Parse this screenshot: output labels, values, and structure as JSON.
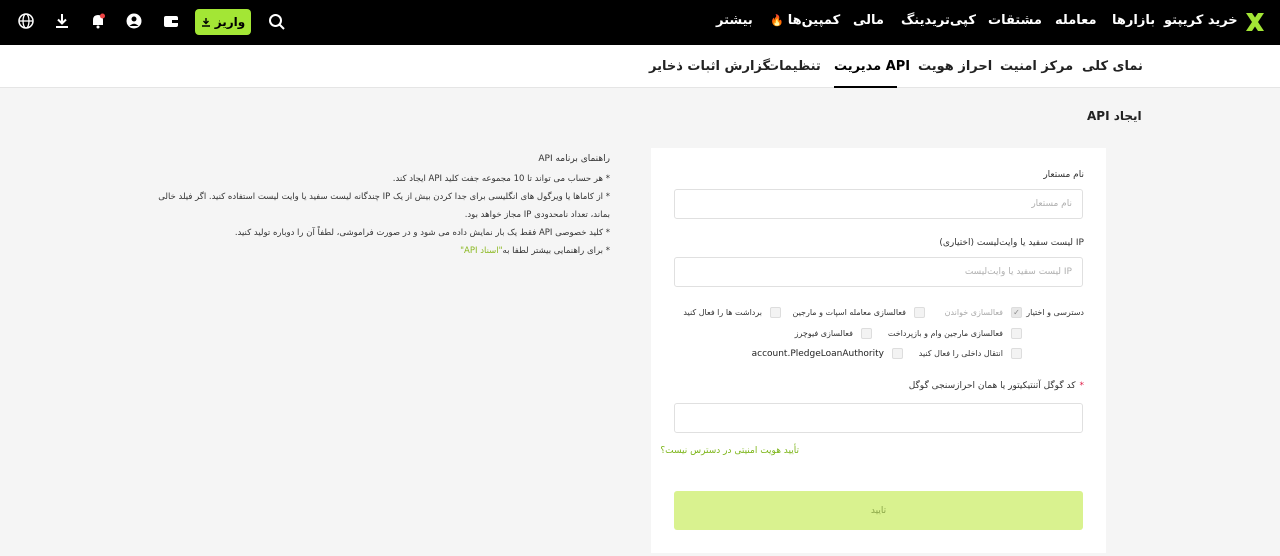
{
  "topbar": {
    "nav": [
      "خرید کریپتو",
      "بازارها",
      "معامله",
      "مشتقات",
      "کپی‌تریدینگ",
      "مالی",
      "کمپین‌ها",
      "بیشتر"
    ],
    "deposit_label": "واریز"
  },
  "subnav": {
    "tabs": [
      "نمای کلی",
      "مرکز امنیت",
      "احراز هویت",
      "مدیریت API",
      "تنظیمات",
      "گزارش اثبات ذخایر"
    ],
    "active": "مدیریت API"
  },
  "page_title": "ایجاد API",
  "guide": {
    "title": "راهنمای برنامه API",
    "items": [
      "* هر حساب می تواند تا 10 مجموعه جفت کلید API ایجاد کند.",
      "* از کاماها یا ویرگول های انگلیسی برای جدا کردن بیش از یک IP چندگانه لیست سفید یا وایت لیست استفاده کنید. اگر فیلد خالی بماند، تعداد نامحدودی IP مجاز خواهد بود.",
      "* کلید خصوصی API فقط یک بار نمایش داده می شود و در صورت فراموشی، لطفاً آن را دوباره تولید کنید.",
      "* برای راهنمایی بیشتر لطفا به"
    ],
    "link": "\"اسناد API\""
  },
  "form": {
    "name_label": "نام مستعار",
    "name_placeholder": "نام مستعار",
    "ip_label": "IP لیست سفید یا وایت‌لیست (اختیاری)",
    "ip_placeholder": "IP لیست سفید یا وایت‌لیست",
    "permissions_label": "دسترسی و اختیار",
    "permissions": [
      {
        "label": "فعالسازی خواندن",
        "checked": true,
        "disabled": true
      },
      {
        "label": "فعالسازی معامله اسپات و مارجین",
        "checked": false,
        "disabled": false
      },
      {
        "label": "برداشت ها را فعال کنید",
        "checked": false,
        "disabled": false
      },
      {
        "label": "فعالسازی مارجین وام و بازپرداخت",
        "checked": false,
        "disabled": false
      },
      {
        "label": "فعالسازی فیوچرز",
        "checked": false,
        "disabled": false
      },
      {
        "label": "انتقال داخلی را فعال کنید",
        "checked": false,
        "disabled": false
      },
      {
        "label": "account.PledgeLoanAuthority",
        "checked": false,
        "disabled": false
      }
    ],
    "required_mark": "*",
    "twofa_label": "کد گوگل آتنتیکیتور یا همان احرازسنجی گوگل",
    "twofa_placeholder": "",
    "id_link": "تأیید هویت امنیتی در دسترس نیست؟",
    "confirm_label": "تایید"
  },
  "colors": {
    "accent": "#a3e635",
    "confirm_bg": "#d9f28f",
    "link": "#7cb518",
    "topbar_bg": "#000000"
  },
  "icons": [
    "logo-x-icon",
    "search-icon",
    "download-icon",
    "wallet-icon",
    "user-icon",
    "bell-icon",
    "app-download-icon",
    "globe-icon"
  ]
}
